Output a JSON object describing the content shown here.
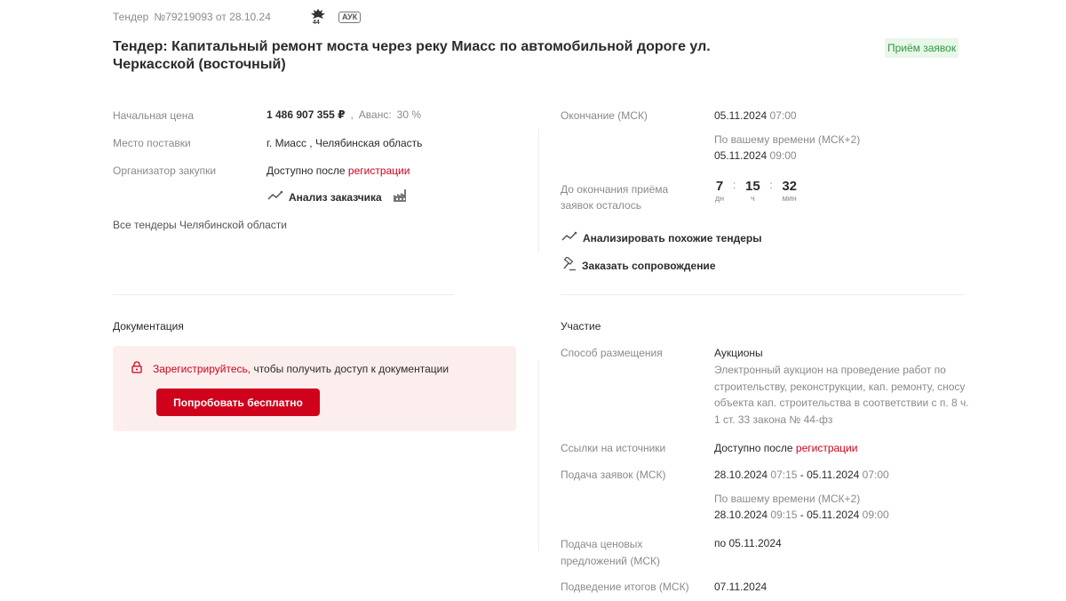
{
  "header": {
    "tender_label": "Тендер",
    "tender_number": "№79219093 от 28.10.24",
    "law_badge": "44",
    "type_badge": "АУК",
    "title": "Тендер: Капитальный ремонт моста через реку Миасс по автомобильной дороге ул. Черкасской (восточный)",
    "status": "Приём заявок"
  },
  "left": {
    "price_label": "Начальная цена",
    "price_value": "1 486 907 355 ₽",
    "advance_label": "Аванс:",
    "advance_value": "30 %",
    "place_label": "Место поставки",
    "place_value": "г. Миасс , Челябинская область",
    "organizer_label": "Организатор закупки",
    "organizer_prefix": "Доступно после",
    "organizer_link": "регистрации",
    "customer_analysis": "Анализ заказчика",
    "all_tenders": "Все тендеры Челябинской области"
  },
  "right": {
    "end_label": "Окончание (МСК)",
    "end_date": "05.11.2024",
    "end_time": "07:00",
    "local_label": "По вашему времени (МСК+2)",
    "local_date": "05.11.2024",
    "local_time": "09:00",
    "remaining_label": "До окончания приёма заявок осталось",
    "timer": {
      "days": "7",
      "days_unit": "дн",
      "hours": "15",
      "hours_unit": "ч",
      "minutes": "32",
      "minutes_unit": "мин"
    },
    "analyze_similar": "Анализировать похожие тендеры",
    "order_support": "Заказать сопровождение"
  },
  "docs": {
    "title": "Документация",
    "register_link": "Зарегистрируйтесь,",
    "register_text": "чтобы получить доступ к документации",
    "try_button": "Попробовать бесплатно"
  },
  "participation": {
    "title": "Участие",
    "method_label": "Способ размещения",
    "method_value": "Аукционы",
    "method_desc": "Электронный аукцион на проведение работ по строительству, реконструкции, кап. ремонту, сносу объекта кап. строительства в соответствии с п. 8 ч. 1 ст. 33 закона № 44-фз",
    "sources_label": "Ссылки на источники",
    "sources_prefix": "Доступно после",
    "sources_link": "регистрации",
    "submit_label": "Подача заявок (МСК)",
    "submit_start_date": "28.10.2024",
    "submit_start_time": "07:15",
    "submit_end_date": "05.11.2024",
    "submit_end_time": "07:00",
    "submit_local_label": "По вашему времени (МСК+2)",
    "submit_local_start_date": "28.10.2024",
    "submit_local_start_time": "09:15",
    "submit_local_end_date": "05.11.2024",
    "submit_local_end_time": "09:00",
    "price_offers_label": "Подача ценовых предложений (МСК)",
    "price_offers_value": "по 05.11.2024",
    "results_label": "Подведение итогов (МСК)",
    "results_value": "07.11.2024"
  }
}
